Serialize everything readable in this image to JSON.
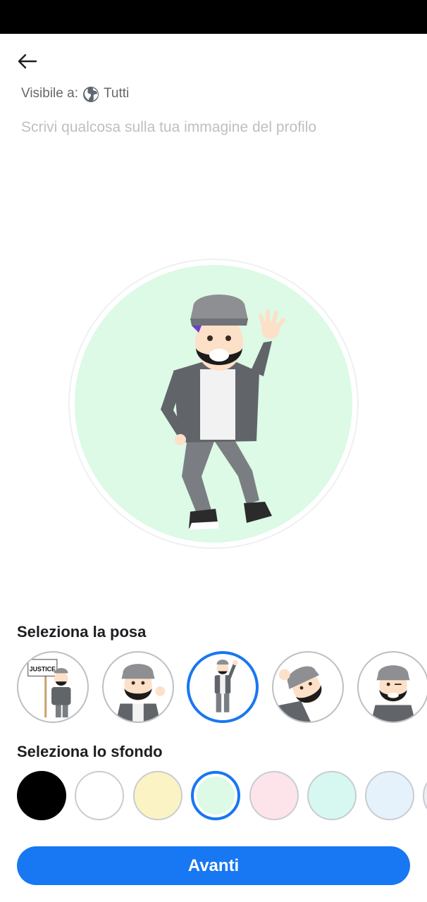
{
  "header": {
    "back_icon": "arrow-left-icon",
    "visibility_label": "Visibile a:",
    "visibility_icon": "globe-icon",
    "visibility_value": "Tutti"
  },
  "caption": {
    "placeholder": "Scrivi qualcosa sulla tua immagine del profilo",
    "value": ""
  },
  "preview": {
    "background_color": "#dcfae6",
    "pose": "waving"
  },
  "pose_section": {
    "title": "Seleziona la posa",
    "sign_text": "JUSTICE",
    "poses": [
      "justice-sign",
      "waving-closeup",
      "waving-full-body",
      "lean-in-wave",
      "wink"
    ],
    "selected_index": 2
  },
  "background_section": {
    "title": "Seleziona lo sfondo",
    "colors": [
      "#000000",
      "#ffffff",
      "#fcf3c4",
      "#dcfae6",
      "#fde3ea",
      "#d6f8f0",
      "#e6f2fb",
      "#eceef2"
    ],
    "selected_index": 3
  },
  "footer": {
    "next_label": "Avanti"
  },
  "theme": {
    "accent": "#1877f2"
  }
}
